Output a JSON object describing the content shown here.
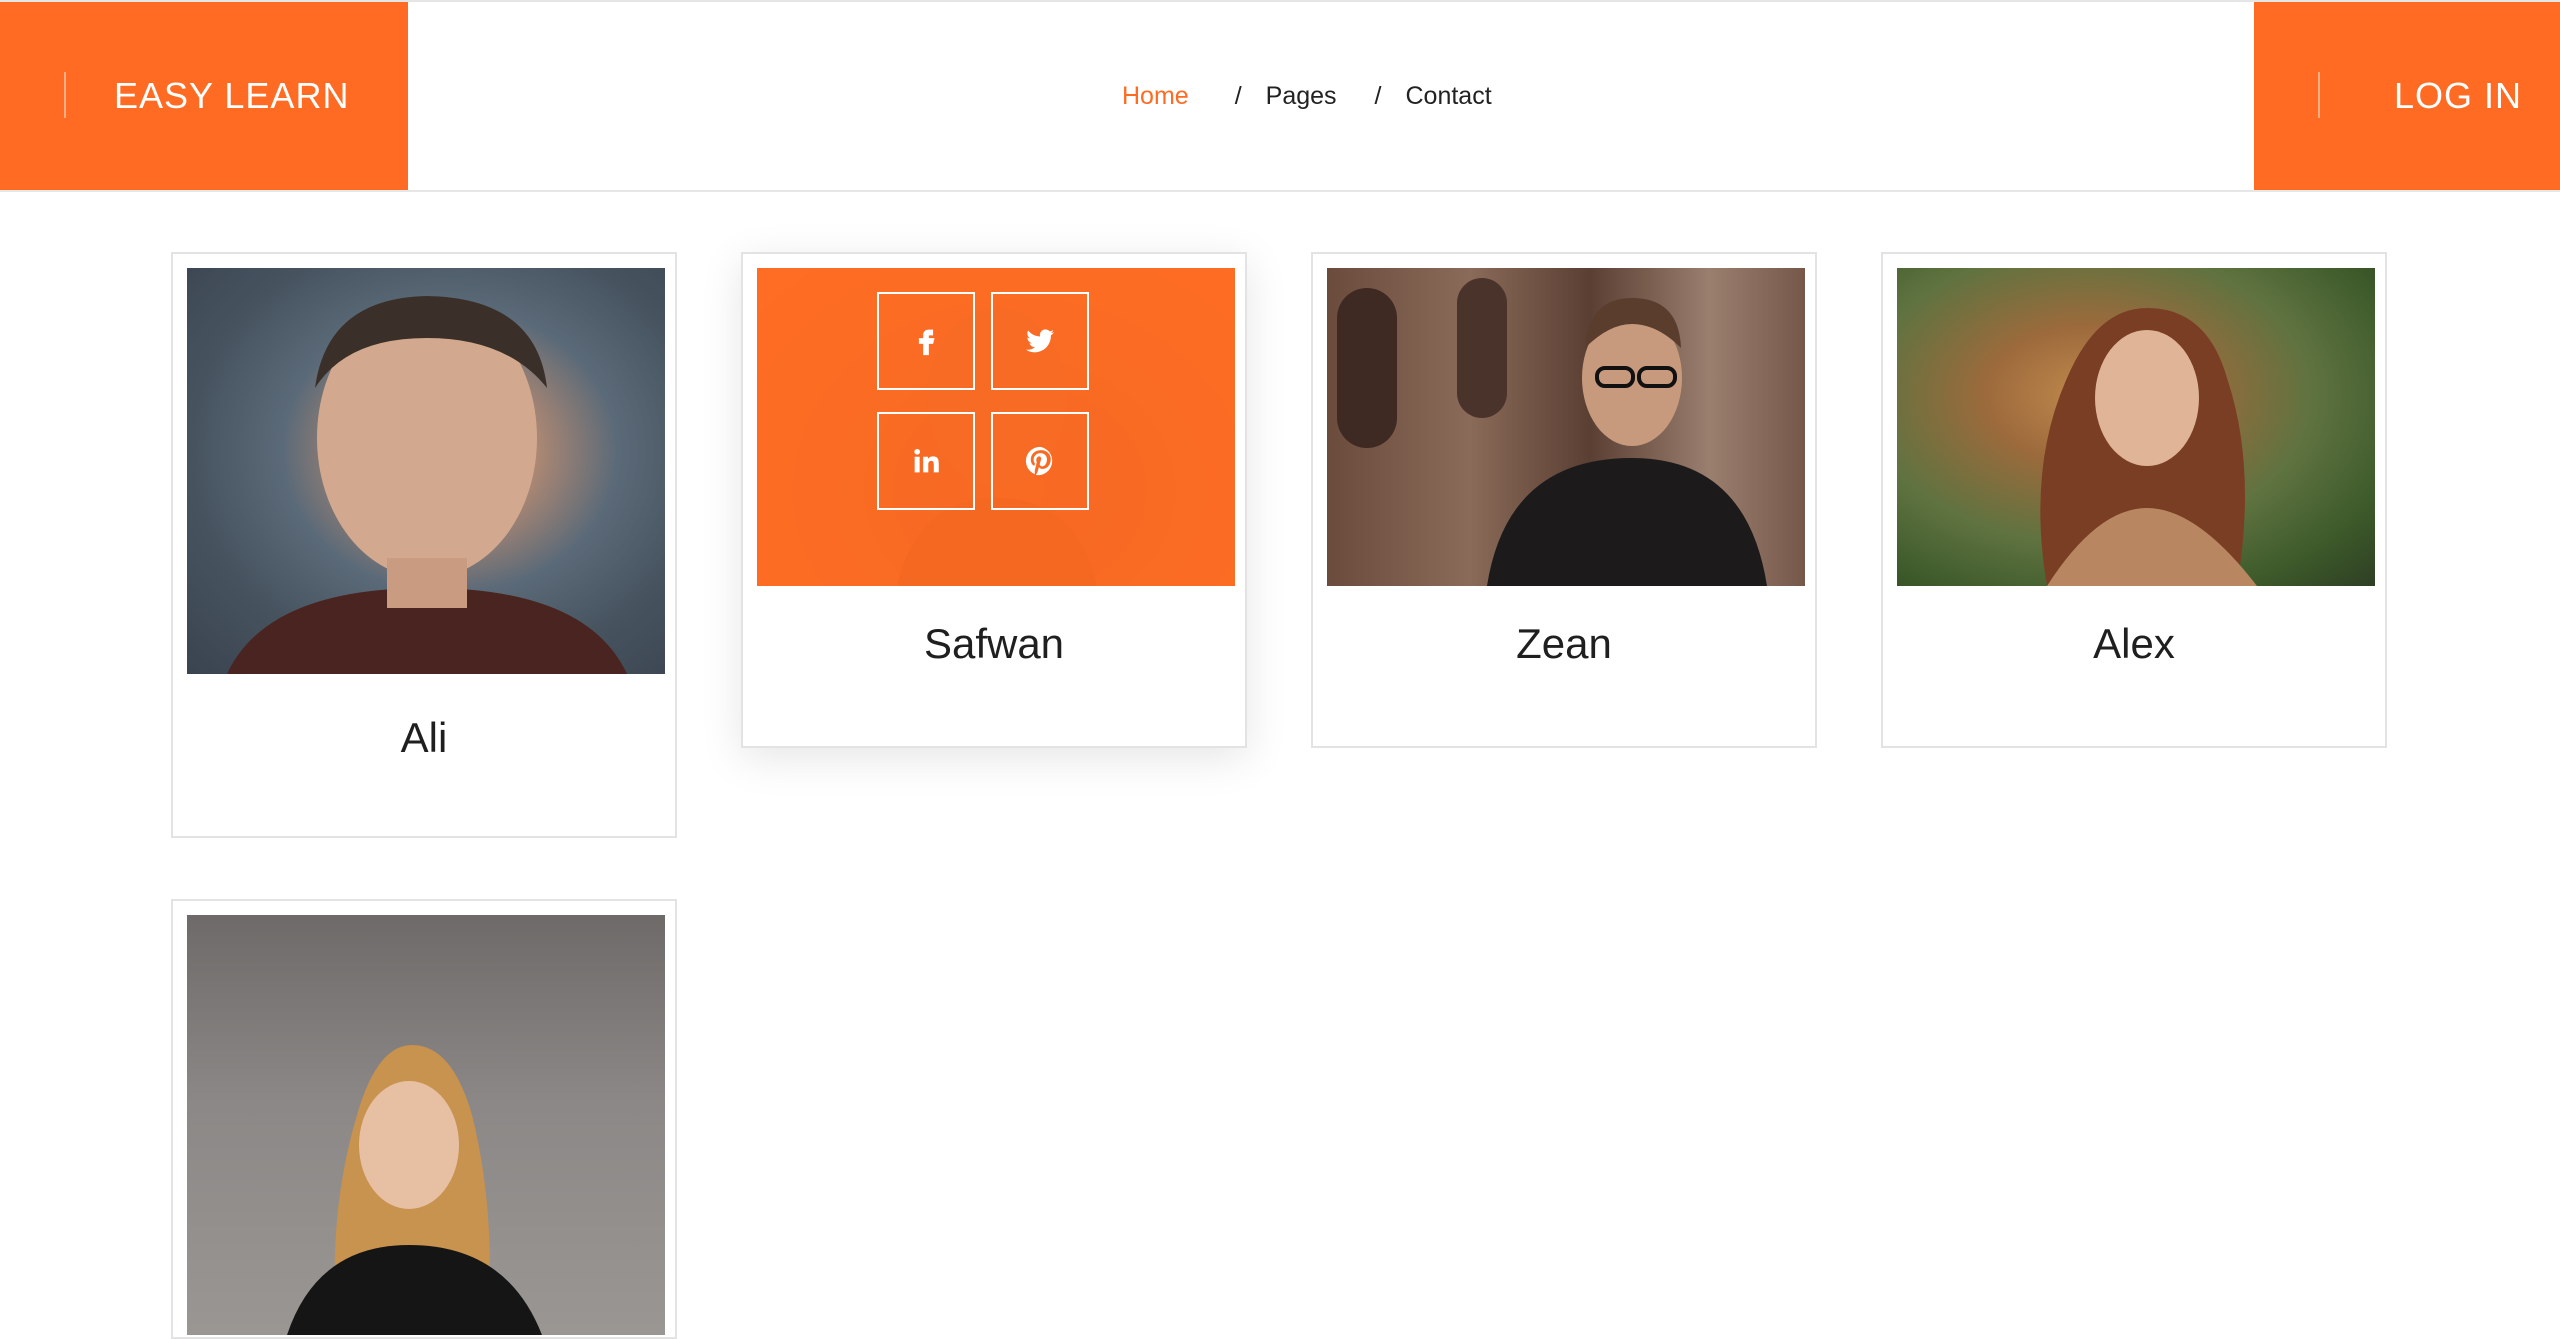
{
  "header": {
    "brand": "EASY LEARN",
    "login_label": "LOG IN",
    "nav": [
      {
        "label": "Home",
        "active": true
      },
      {
        "label": "Pages",
        "active": false
      },
      {
        "label": "Contact",
        "active": false
      }
    ],
    "separator": "/"
  },
  "colors": {
    "accent": "#ff6b22",
    "border": "#e3e3e3",
    "text": "#1f1f1f"
  },
  "team": [
    {
      "name": "Ali"
    },
    {
      "name": "Safwan",
      "social_icons": [
        "facebook-icon",
        "twitter-icon",
        "linkedin-icon",
        "pinterest-icon"
      ]
    },
    {
      "name": "Zean"
    },
    {
      "name": "Alex"
    },
    {
      "name": ""
    }
  ]
}
